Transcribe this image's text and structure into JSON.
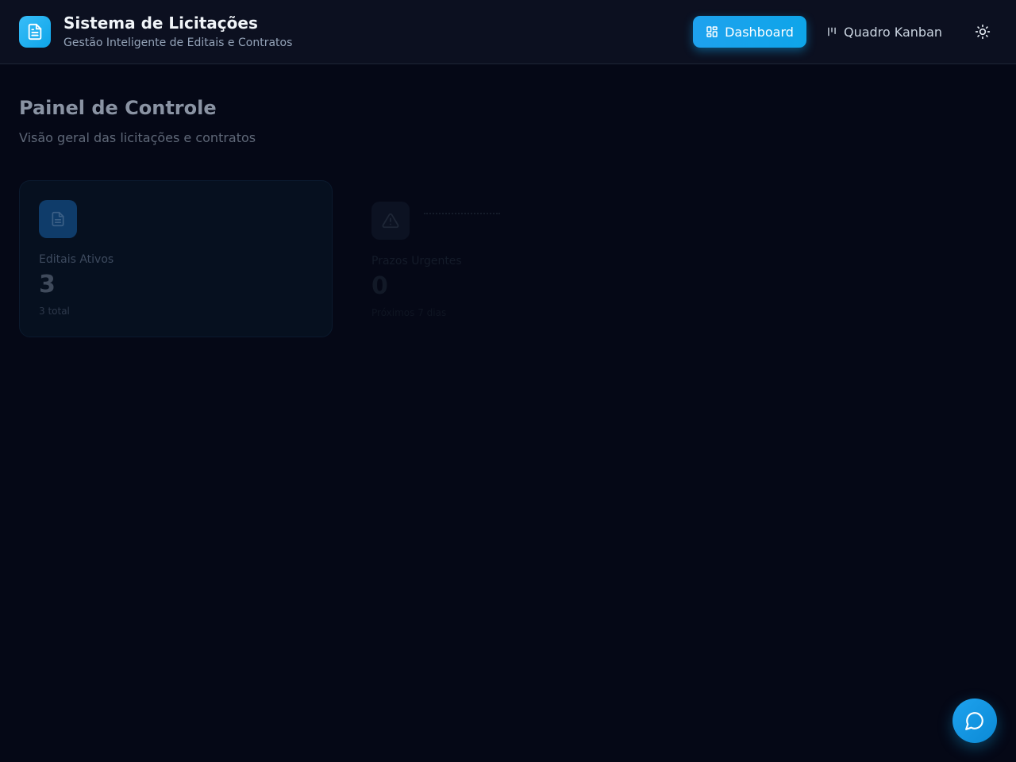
{
  "header": {
    "title": "Sistema de Licitações",
    "subtitle": "Gestão Inteligente de Editais e Contratos",
    "logo_icon": "file-text-icon",
    "nav": {
      "dashboard_label": "Dashboard",
      "kanban_label": "Quadro Kanban"
    },
    "theme_icon": "sun-icon"
  },
  "main": {
    "title": "Painel de Controle",
    "subtitle": "Visão geral das licitações e contratos",
    "cards": [
      {
        "label": "Editais Ativos",
        "value": "3",
        "note": "3 total",
        "icon": "file-text-icon"
      },
      {
        "label": "Prazos Urgentes",
        "value": "0",
        "note": "Próximos 7 dias",
        "icon": "alert-triangle-icon"
      }
    ]
  },
  "chat_button": {
    "icon": "message-circle-icon"
  },
  "colors": {
    "accent": "#0ea5e9",
    "background": "#050816",
    "header_background": "#0c1020"
  }
}
